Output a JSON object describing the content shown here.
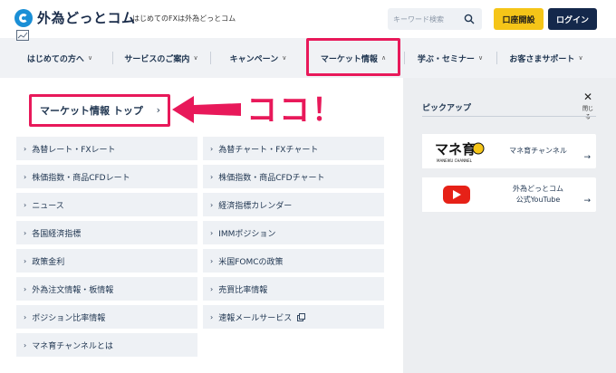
{
  "header": {
    "logo_text": "外為どっとコム",
    "tagline": "はじめてのFXは外為どっとコム",
    "search_placeholder": "キーワード検索",
    "account_button": "口座開設",
    "login_button": "ログイン"
  },
  "nav": {
    "items": [
      {
        "label": "はじめての方へ"
      },
      {
        "label": "サービスのご案内"
      },
      {
        "label": "キャンペーン"
      },
      {
        "label": "マーケット情報"
      },
      {
        "label": "学ぶ・セミナー"
      },
      {
        "label": "お客さまサポート"
      }
    ],
    "active_index": 3
  },
  "main": {
    "top_link": "マーケット情報 トップ",
    "annotation": "ココ！",
    "links": [
      {
        "label": "為替レート・FXレート"
      },
      {
        "label": "為替チャート・FXチャート"
      },
      {
        "label": "株価指数・商品CFDレート"
      },
      {
        "label": "株価指数・商品CFDチャート"
      },
      {
        "label": "ニュース"
      },
      {
        "label": "経済指標カレンダー"
      },
      {
        "label": "各国経済指標"
      },
      {
        "label": "IMMポジション"
      },
      {
        "label": "政策金利"
      },
      {
        "label": "米国FOMCの政策"
      },
      {
        "label": "外為注文情報・板情報"
      },
      {
        "label": "売買比率情報"
      },
      {
        "label": "ポジション比率情報"
      },
      {
        "label": "速報メールサービス",
        "external": true
      },
      {
        "label": "マネ育チャンネルとは"
      }
    ]
  },
  "sidebar": {
    "close_label": "閉じる",
    "pickup_title": "ピックアップ",
    "cards": [
      {
        "thumb_text": "マネ育",
        "thumb_sub": "MANEIKU CHANNEL",
        "label": "マネ育チャンネル"
      },
      {
        "thumb_text": "",
        "label_line1": "外為どっとコム",
        "label_line2": "公式YouTube"
      }
    ]
  },
  "colors": {
    "accent_pink": "#e8195a",
    "navy": "#14284b",
    "yellow": "#f5c518",
    "link_bg": "#eef1f5"
  }
}
